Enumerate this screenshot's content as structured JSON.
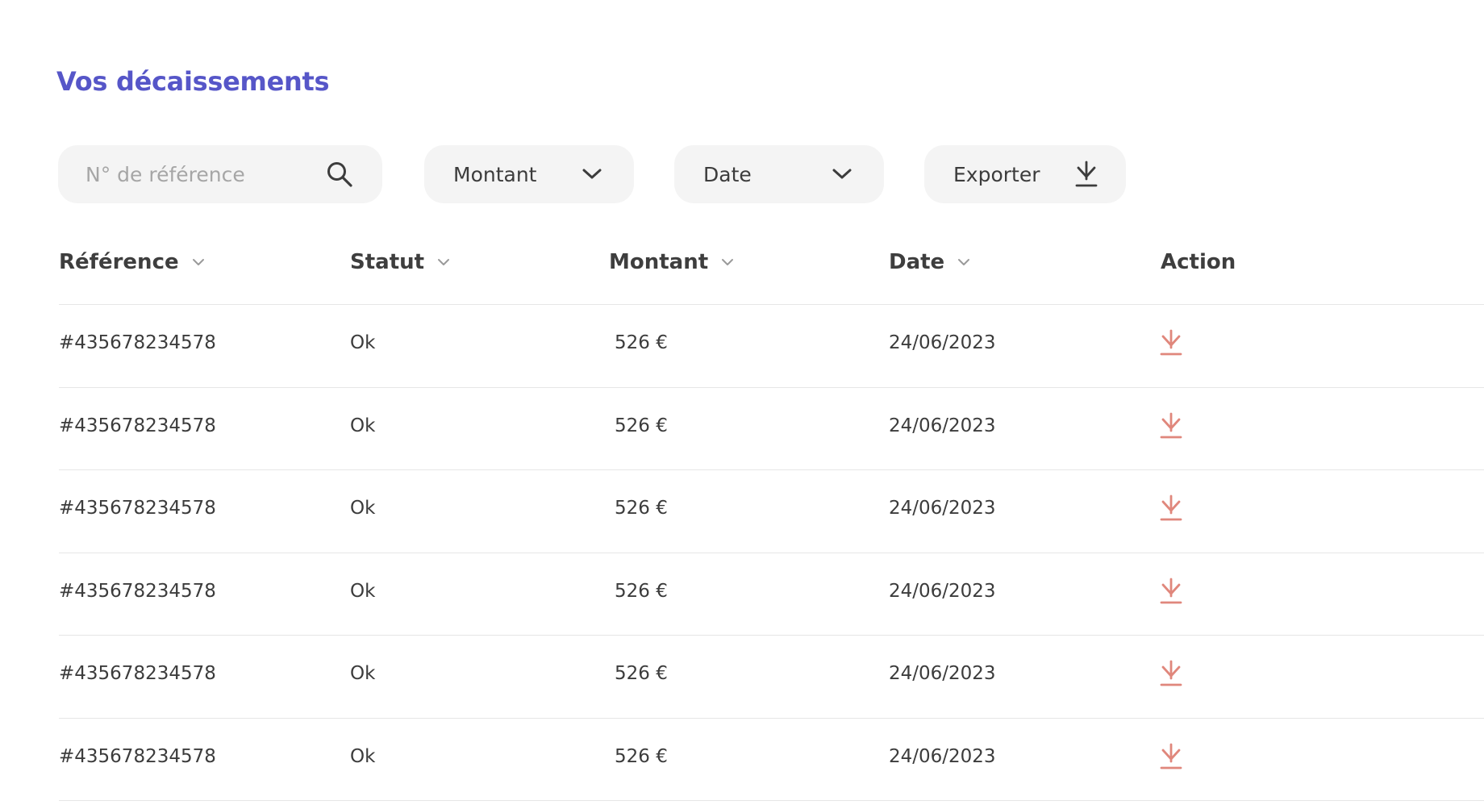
{
  "page": {
    "title": "Vos décaissements"
  },
  "toolbar": {
    "search_placeholder": "N° de référence",
    "search_value": "",
    "montant_label": "Montant",
    "date_label": "Date",
    "export_label": "Exporter"
  },
  "table": {
    "headers": {
      "reference": "Référence",
      "statut": "Statut",
      "montant": "Montant",
      "date": "Date",
      "action": "Action"
    },
    "rows": [
      {
        "reference": "#435678234578",
        "statut": "Ok",
        "montant": "526 €",
        "date": "24/06/2023"
      },
      {
        "reference": "#435678234578",
        "statut": "Ok",
        "montant": "526 €",
        "date": "24/06/2023"
      },
      {
        "reference": "#435678234578",
        "statut": "Ok",
        "montant": "526 €",
        "date": "24/06/2023"
      },
      {
        "reference": "#435678234578",
        "statut": "Ok",
        "montant": "526 €",
        "date": "24/06/2023"
      },
      {
        "reference": "#435678234578",
        "statut": "Ok",
        "montant": "526 €",
        "date": "24/06/2023"
      },
      {
        "reference": "#435678234578",
        "statut": "Ok",
        "montant": "526 €",
        "date": "24/06/2023"
      }
    ]
  },
  "icons": {
    "search": "search-icon",
    "dropdown": "chevron-down-icon",
    "sort": "sort-chevron-icon",
    "export": "download-icon",
    "row_action": "download-icon"
  },
  "colors": {
    "title": "#5656c8",
    "control_bg": "#f4f4f4",
    "action_icon": "#e0877c",
    "divider": "#e6e6e6"
  }
}
